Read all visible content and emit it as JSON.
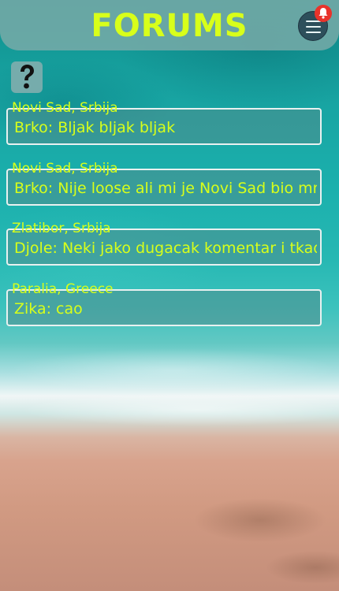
{
  "header": {
    "title": "FORUMS"
  },
  "icons": {
    "menu": "hamburger-icon",
    "notification": "bell-icon",
    "help": "question-icon"
  },
  "colors": {
    "accent": "#d8ff1a",
    "header_bg": "#78aaa8",
    "notification_badge": "#e8332b"
  },
  "forums": [
    {
      "location": "Novi Sad, Srbija",
      "message": "Brko: Bljak bljak bljak"
    },
    {
      "location": "Novi Sad, Srbija",
      "message": "Brko: Nije loose ali mi je Novi Sad bio mnogo"
    },
    {
      "location": "Zlatibor, Srbija",
      "message": "Djole: Neki jako dugacak komentar i tkao"
    },
    {
      "location": "Paralia, Greece",
      "message": "Zika: cao"
    }
  ]
}
